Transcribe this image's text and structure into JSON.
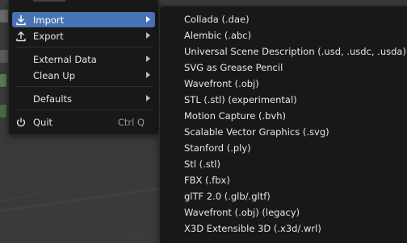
{
  "colors": {
    "menu_bg": "#181818",
    "highlight": "#4772b3",
    "text": "#e6e6e6",
    "shortcut_text": "#9a9a9a",
    "viewport_bg": "#3a3a3a"
  },
  "file_menu": {
    "items": [
      {
        "label": "Import",
        "icon": "import-icon",
        "has_submenu": true,
        "highlighted": true
      },
      {
        "label": "Export",
        "icon": "export-icon",
        "has_submenu": true
      },
      {
        "label": "External Data",
        "has_submenu": true
      },
      {
        "label": "Clean Up",
        "has_submenu": true
      },
      {
        "label": "Defaults",
        "has_submenu": true
      },
      {
        "label": "Quit",
        "icon": "power-icon",
        "shortcut": "Ctrl Q"
      }
    ]
  },
  "import_submenu": {
    "items": [
      {
        "label": "Collada (.dae)"
      },
      {
        "label": "Alembic (.abc)"
      },
      {
        "label": "Universal Scene Description (.usd, .usdc, .usda)"
      },
      {
        "label": "SVG as Grease Pencil"
      },
      {
        "label": "Wavefront (.obj)"
      },
      {
        "label": "STL (.stl) (experimental)"
      },
      {
        "label": "Motion Capture (.bvh)"
      },
      {
        "label": "Scalable Vector Graphics (.svg)"
      },
      {
        "label": "Stanford (.ply)"
      },
      {
        "label": "Stl (.stl)"
      },
      {
        "label": "FBX (.fbx)"
      },
      {
        "label": "glTF 2.0 (.glb/.gltf)"
      },
      {
        "label": "Wavefront (.obj) (legacy)"
      },
      {
        "label": "X3D Extensible 3D (.x3d/.wrl)"
      }
    ]
  }
}
